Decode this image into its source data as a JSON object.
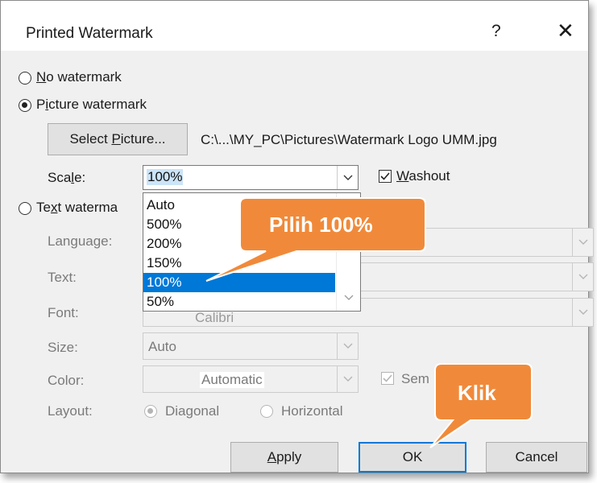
{
  "dialog": {
    "title": "Printed Watermark",
    "help": "?",
    "close": "✕"
  },
  "options": {
    "no_watermark": {
      "pre": "",
      "u": "N",
      "post": "o watermark",
      "selected": false
    },
    "picture_watermark": {
      "pre": "P",
      "u": "i",
      "post": "cture watermark",
      "selected": true
    },
    "text_watermark": {
      "pre": "Te",
      "u": "x",
      "post": "t waterma",
      "selected": false
    }
  },
  "picture": {
    "select_btn": {
      "pre": "Select ",
      "u": "P",
      "post": "icture..."
    },
    "path": "C:\\...\\MY_PC\\Pictures\\Watermark Logo UMM.jpg",
    "scale_label": {
      "pre": "Sca",
      "u": "l",
      "post": "e:"
    },
    "scale_value": "100%",
    "washout": {
      "u": "W",
      "post": "ashout",
      "checked": true
    }
  },
  "scale_options": [
    "Auto",
    "500%",
    "200%",
    "150%",
    "100%",
    "50%"
  ],
  "scale_selected_index": 4,
  "text_section": {
    "language_label": "Language:",
    "text_label": "Text:",
    "font_label": "Font:",
    "font_value_partial": "Calibri",
    "size_label": "Size:",
    "size_value": "Auto",
    "color_label": "Color:",
    "color_value": "Automatic",
    "semi_label_partial": "Sem",
    "layout_label": "Layout:",
    "layout_diagonal": "Diagonal",
    "layout_horizontal": "Horizontal"
  },
  "buttons": {
    "apply": {
      "u": "A",
      "post": "pply"
    },
    "ok": "OK",
    "cancel": "Cancel"
  },
  "annotations": {
    "scale_callout": "Pilih 100%",
    "ok_callout": "Klik",
    "callout_color": "#f08a3a"
  }
}
